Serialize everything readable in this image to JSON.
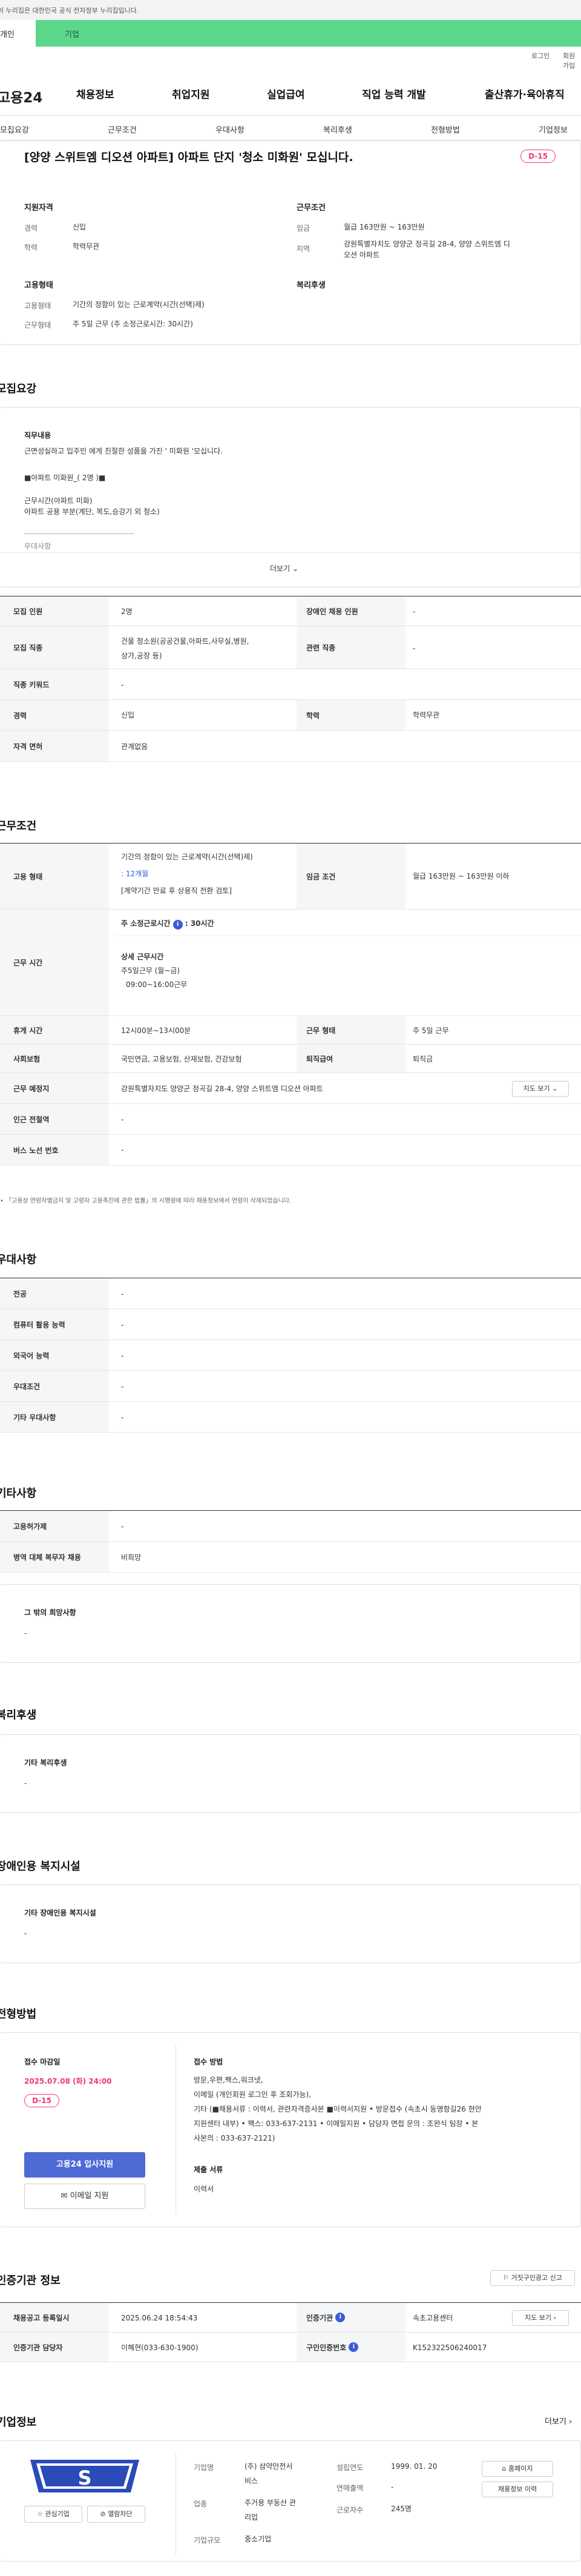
{
  "gov_banner": "이 누리집은 대한민국 공식 전자정부 누리집입니다.",
  "tabs": {
    "personal": "개인",
    "company": "기업"
  },
  "util": {
    "login": "로그인",
    "signup": "회원가입"
  },
  "logo": "고용24",
  "gnb": [
    "채용정보",
    "취업지원",
    "실업급여",
    "직업 능력 개발",
    "출산휴가·육아휴직"
  ],
  "subnav": [
    "모집요강",
    "근무조건",
    "우대사항",
    "복리후생",
    "전형방법",
    "기업정보"
  ],
  "job_title": "[양양 스위트엠 디오션 아파트] 아파트 단지 '청소 미화원' 모십니다.",
  "dday": "D-15",
  "summary": {
    "qual_h": "지원자격",
    "career_k": "경력",
    "career_v": "신입",
    "edu_k": "학력",
    "edu_v": "학력무관",
    "cond_h": "근무조건",
    "wage_k": "임금",
    "wage_v": "월급 163만원 ~ 163만원",
    "area_k": "지역",
    "area_v1": "강원특별자치도 양양군 정곡길 28-4, 양양 스위트엠 디",
    "area_v2": "오션 아파트",
    "emp_h": "고용형태",
    "etype_k": "고용형태",
    "etype_v": "기간의 정함이 있는 근로계약(시간(선택)제)",
    "whour_k": "근무형태",
    "whour_v": "주 5일 근무 (주 소정근로시간: 30시간)",
    "welfare_h": "복리후생"
  },
  "recruit": {
    "section": "모집요강",
    "duty_h": "직무내용",
    "duty_lines": [
      "근면성실하고 입주민 에게 친절한 성품을 가진 ' 미화원 '모십니다.",
      "",
      "■아파트 미화원_( 2명 )■",
      "",
      "근무시간(아파트 미화)",
      "아파트 공용 부분(계단, 복도,승강기 외 청소)",
      "",
      "------------------------------------------",
      "우대사항"
    ],
    "more": "더보기",
    "rows": {
      "count_k": "모집 인원",
      "count_v": "2명",
      "dis_k": "장애인 채용 인원",
      "dis_v": "-",
      "job_k": "모집 직종",
      "job_v1": "건물 청소원(공공건물,아파트,사무실,병원,",
      "job_v2": "상가,공장 등)",
      "rel_k": "관련 직종",
      "rel_v": "-",
      "kw_k": "직종 키워드",
      "kw_v": "-",
      "car_k": "경력",
      "car_v": "신입",
      "edu_k": "학력",
      "edu_v": "학력무관",
      "lic_k": "자격 면허",
      "lic_v": "관계없음"
    }
  },
  "work": {
    "section": "근무조건",
    "emp_k": "고용 형태",
    "emp_v1": "기간의 정함이 있는 근로계약(시간(선택)제)",
    "emp_v2": ": 12개월",
    "emp_v3": "[계약기간 만료 후 상용직 전환 검토]",
    "wage_k": "임금 조건",
    "wage_v": "월급 163만원 ~ 163만원 이하",
    "time_k": "근무 시간",
    "time_h": "주 소정근로시간",
    "time_hv": ": 30시간",
    "time_d_h": "상세 근무시간",
    "time_d1": "주5일근무 (월~금)",
    "time_d2": "09:00~16:00근무",
    "rest_k": "휴게 시간",
    "rest_v": "12시00분~13시00분",
    "form_k": "근무 형태",
    "form_v": "주 5일 근무",
    "ins_k": "사회보험",
    "ins_v": "국민연금, 고용보험, 산재보험, 건강보험",
    "ret_k": "퇴직급여",
    "ret_v": "퇴직금",
    "loc_k": "근무 예정지",
    "loc_v": "강원특별자치도 양양군 정곡길 28-4, 양양 스위트엠 디오션 아파트",
    "map_btn": "지도 보기",
    "sub_k": "인근 전철역",
    "sub_v": "-",
    "bus_k": "버스 노선 번호",
    "bus_v": "-",
    "note": "「고용상 연령차별금지 및 고령자 고용촉진에 관한 법률」의 시행령에 따라 채용정보에서 연령이 삭제되었습니다."
  },
  "pref": {
    "section": "우대사항",
    "rows": [
      {
        "k": "전공",
        "v": "-"
      },
      {
        "k": "컴퓨터 활용 능력",
        "v": "-"
      },
      {
        "k": "외국어 능력",
        "v": "-"
      },
      {
        "k": "우대조건",
        "v": "-"
      },
      {
        "k": "기타 우대사항",
        "v": "-"
      }
    ]
  },
  "etc": {
    "section": "기타사항",
    "emp_k": "고용허가제",
    "emp_v": "-",
    "mil_k": "병역 대체 복무자 채용",
    "mil_v": "비희망",
    "other_h": "그 밖의 희망사항",
    "other_v": "-"
  },
  "welfare": {
    "section": "복리후생",
    "h": "기타 복리후생",
    "v": "-"
  },
  "disab": {
    "section": "장애인용 복지시설",
    "h": "기타 장애인용 복지시설",
    "v": "-"
  },
  "process": {
    "section": "전형방법",
    "deadline_h": "접수 마감일",
    "deadline_v": "2025.07.08 (화) 24:00",
    "dday": "D-15",
    "apply_btn": "고용24 입사지원",
    "mail_btn": "이메일 지원",
    "method_h": "접수 방법",
    "method_lines": [
      "방문,우편,팩스,워크넷,",
      "이메일 (개인회원 로그인 후 조회가능),",
      "기타 (■채용서류 : 이력서, 관련자격증사본 ■이력서지원 • 방문접수 (속초시 동명항길26 현안",
      "지원센터 내부) • 팩스: 033-637-2131 • 이메일지원 • 담당자 면접 문의 : 조완식 팀장 •  본",
      "사본의 : 033-637-2121)"
    ],
    "docs_h": "제출 서류",
    "docs_v": "이력서"
  },
  "agency": {
    "section": "인증기관 정보",
    "report_btn": "거짓구인광고 신고",
    "reg_k": "채용공고 등록일시",
    "reg_v": "2025.06.24 18:54:43",
    "org_k": "인증기관",
    "org_v": "속초고용센터",
    "map_btn": "지도 보기",
    "mgr_k": "인증기관 담당자",
    "mgr_v": "이혜현(033-630-1900)",
    "no_k": "구인인증번호",
    "no_v": "K152322506240017"
  },
  "company": {
    "section": "기업정보",
    "more": "더보기",
    "logo_text": "S",
    "fav_btn": "관심기업",
    "blk_btn": "열람차단",
    "name_k": "기업명",
    "name_v1": "(주) 삼약안전서",
    "name_v2": "비스",
    "biz_k": "업종",
    "biz_v1": "주거용 부동산 관",
    "biz_v2": "리업",
    "size_k": "기업규모",
    "size_v": "중소기업",
    "est_k": "설립연도",
    "est_v": "1999. 01. 20",
    "sales_k": "연매출액",
    "sales_v": "-",
    "emp_k": "근로자수",
    "emp_v": "245명",
    "home_btn": "홈페이지",
    "jobs_btn": "채용정보 이력"
  },
  "colors": {
    "accent": "#5cd68b",
    "dday": "#ee3a6b",
    "apply": "#4d6ad5"
  }
}
